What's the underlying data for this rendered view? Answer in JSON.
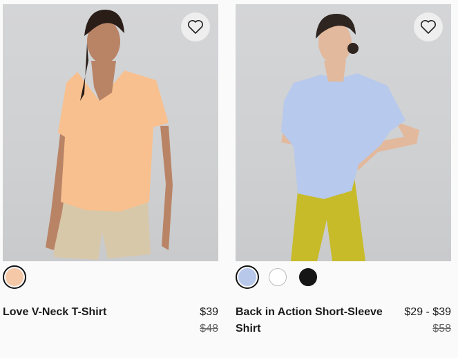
{
  "products": [
    {
      "name": "Love V-Neck T-Shirt",
      "price": "$39",
      "original_price": "$48",
      "swatches": [
        {
          "color": "#f5c9a7",
          "selected": true
        }
      ],
      "shirt_color": "#f8c08e",
      "bottom_color": "#d8c8aa"
    },
    {
      "name": "Back in Action Short-Sleeve Shirt",
      "price": "$29 - $39",
      "original_price": "$58",
      "swatches": [
        {
          "color": "#b8c8ea",
          "selected": true
        },
        {
          "color": "#ffffff",
          "selected": false
        },
        {
          "color": "#151515",
          "selected": false
        }
      ],
      "shirt_color": "#b7c9ec",
      "bottom_color": "#c7bb2a"
    }
  ],
  "icons": {
    "favorite": "heart-outline-icon"
  }
}
